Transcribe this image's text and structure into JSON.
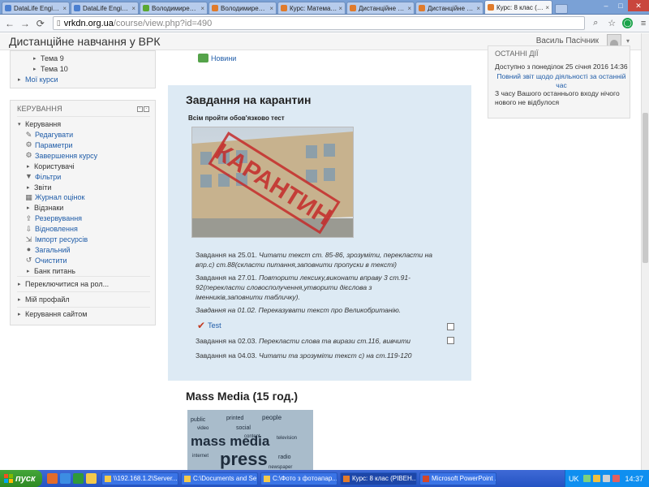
{
  "browser": {
    "tabs": [
      {
        "title": "DataLife Engine -",
        "icon_color": "#4a7fd0"
      },
      {
        "title": "DataLife Engine -",
        "icon_color": "#4a7fd0"
      },
      {
        "title": "Володимирецьк",
        "icon_color": "#5aa832"
      },
      {
        "title": "Володимирецьк",
        "icon_color": "#e07b2c"
      },
      {
        "title": "Курс: Математи",
        "icon_color": "#e07b2c"
      },
      {
        "title": "Дистанційне нав",
        "icon_color": "#e07b2c"
      },
      {
        "title": "Дистанційне нав",
        "icon_color": "#e07b2c"
      },
      {
        "title": "Курс: 8 клас (РІВ",
        "icon_color": "#e07b2c",
        "active": true
      }
    ],
    "url_host": "vrkdn.org.ua",
    "url_path": "/course/view.php?id=490"
  },
  "header": {
    "site_title": "Дистанційне навчання у ВРК",
    "user_name": "Василь Пасічник"
  },
  "nav_block": {
    "items": [
      "Тема 9",
      "Тема 10",
      "Мої курси"
    ]
  },
  "admin_block": {
    "title": "КЕРУВАННЯ",
    "root": "Керування",
    "items": [
      {
        "label": "Редагувати",
        "link": true,
        "icon": "pencil-icon"
      },
      {
        "label": "Параметри",
        "link": true,
        "icon": "gear-icon"
      },
      {
        "label": "Завершення курсу",
        "link": true,
        "icon": "gear-icon"
      },
      {
        "label": "Користувачі",
        "link": false,
        "icon": "arrow"
      },
      {
        "label": "Фільтри",
        "link": true,
        "icon": "filter-icon"
      },
      {
        "label": "Звіти",
        "link": false,
        "icon": "arrow"
      },
      {
        "label": "Журнал оцінок",
        "link": true,
        "icon": "grades-icon"
      },
      {
        "label": "Відзнаки",
        "link": false,
        "icon": "arrow"
      },
      {
        "label": "Резервування",
        "link": true,
        "icon": "backup-icon"
      },
      {
        "label": "Відновлення",
        "link": true,
        "icon": "restore-icon"
      },
      {
        "label": "Імпорт ресурсів",
        "link": true,
        "icon": "import-icon"
      },
      {
        "label": "Загальний",
        "link": true,
        "icon": "globe-icon"
      },
      {
        "label": "Очистити",
        "link": true,
        "icon": "reset-icon"
      },
      {
        "label": "Банк питань",
        "link": false,
        "icon": "arrow"
      }
    ],
    "switch_role": "Переключитися на рол...",
    "my_profile": "Мій профайл",
    "site_admin": "Керування сайтом"
  },
  "content": {
    "news_label": "Новини",
    "section_title": "Завдання на карантин",
    "section_subtitle": "Всім пройти обов'язково тест",
    "image_stamp_text": "КАРАНТИН",
    "tasks": [
      {
        "prefix": "Завдання на 25.01.",
        "text": "Читати текст ст. 85-86, зрозуміти, перекласти на впр.с) ст.88(скласти питання,заповнити пропуски в тексті)"
      },
      {
        "prefix": "Завдання на 27.01.",
        "text": "Повторити лексику,виконати вправу 3 ст.91-92(перекласти словосполучення,утворити дієслова з іменників,заповнити табличку)."
      },
      {
        "prefix": "",
        "text": "Завдання на 01.02. Переказувати текст про Великобританію."
      }
    ],
    "test_label": "Test",
    "task_0203_prefix": "Завдання на 02.03.",
    "task_0203_text": "Перекласти слова та вирази ст.116, вивчити",
    "task_0403_prefix": "Завдання на 04.03.",
    "task_0403_text": "Читати та зрозуміти текст с) на ст.119-120",
    "next_section_title": "Mass Media (15 год.)",
    "mm_words": [
      "public",
      "printed",
      "people",
      "video",
      "social",
      "mass media",
      "press",
      "television",
      "radio",
      "internet",
      "newspaper",
      "content"
    ]
  },
  "recent_block": {
    "title": "ОСТАННІ ДІЇ",
    "since": "Доступно з понеділок 25 січня 2016 14:36",
    "full_report": "Повний звіт щодо діяльності за останній час",
    "nothing_new": "З часу Вашого останнього входу нічого нового не відбулося"
  },
  "taskbar": {
    "start_label": "пуск",
    "buttons": [
      {
        "label": "\\\\192.168.1.2\\Server...",
        "icon_color": "#f3c94b"
      },
      {
        "label": "C:\\Documents and Se...",
        "icon_color": "#f3c94b"
      },
      {
        "label": "C:\\Фото з фотоапар...",
        "icon_color": "#f3c94b"
      },
      {
        "label": "Курс: 8 клас (РІВЕН...",
        "icon_color": "#e07b2c",
        "active": true
      },
      {
        "label": "Microsoft PowerPoint ...",
        "icon_color": "#d2472b"
      }
    ],
    "lang": "UK",
    "clock": "14:37"
  }
}
